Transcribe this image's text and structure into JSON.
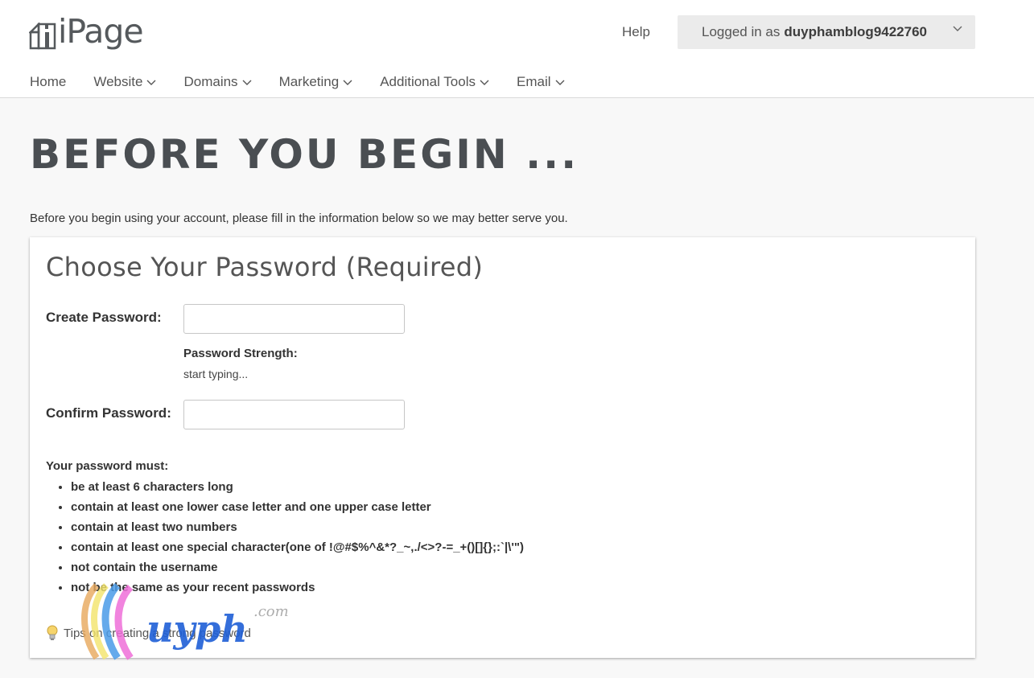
{
  "header": {
    "logo_text": "iPage",
    "help_label": "Help",
    "account": {
      "prefix": "Logged in as",
      "username": "duyphamblog9422760"
    }
  },
  "nav": {
    "items": [
      {
        "label": "Home"
      },
      {
        "label": "Website"
      },
      {
        "label": "Domains"
      },
      {
        "label": "Marketing"
      },
      {
        "label": "Additional Tools"
      },
      {
        "label": "Email"
      }
    ]
  },
  "main": {
    "title": "BEFORE YOU BEGIN ...",
    "intro": "Before you begin using your account, please fill in the information below so we may better serve you."
  },
  "form": {
    "heading": "Choose Your Password (Required)",
    "create_label": "Create Password:",
    "create_value": "",
    "strength_label": "Password Strength:",
    "strength_value": "start typing...",
    "confirm_label": "Confirm Password:",
    "confirm_value": "",
    "rules_title": "Your password must:",
    "rules": [
      "be at least 6 characters long",
      "contain at least one lower case letter and one upper case letter",
      "contain at least two numbers",
      "contain at least one special character(one of !@#$%^&*?_~,./<>?-=_+()[]{};:`|\\'\")",
      "not contain the username",
      "not be the same as your recent passwords"
    ],
    "tips_label": "Tips on creating a strong password"
  },
  "watermark": {
    "text": "uyph",
    "suffix": ".com"
  },
  "colors": {
    "page_bg": "#f8f8f8",
    "heading": "#4a4e52",
    "account_bg": "#ebebeb"
  }
}
